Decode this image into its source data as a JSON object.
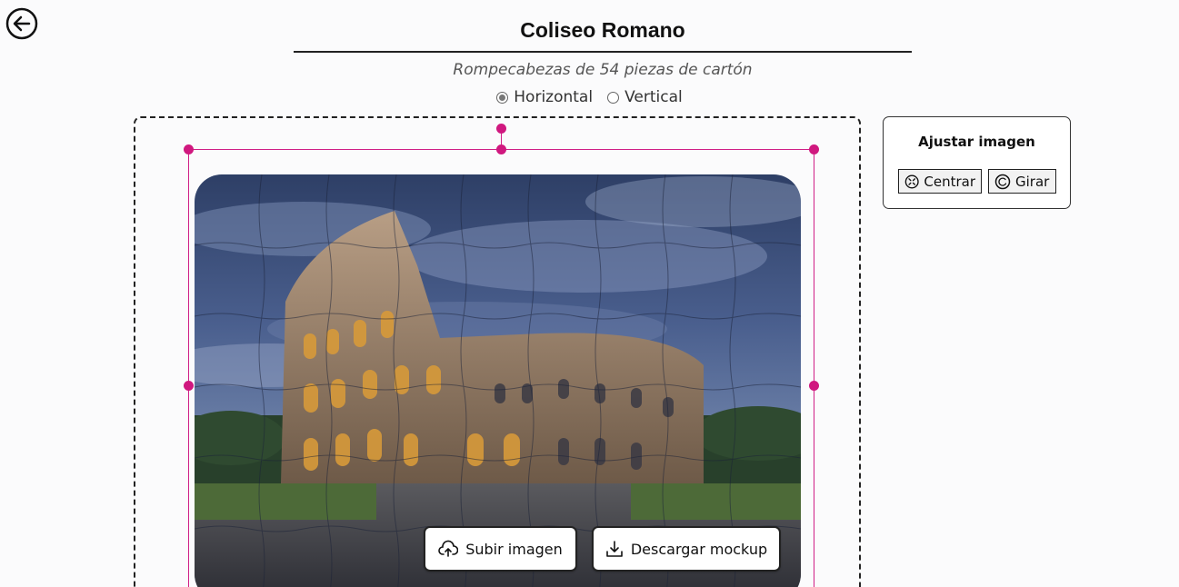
{
  "header": {
    "back_icon": "arrow-left-circle-icon",
    "title": "Coliseo Romano",
    "subtitle": "Rompecabezas de 54 piezas de cartón"
  },
  "orientation": {
    "options": [
      {
        "label": "Horizontal",
        "selected": true
      },
      {
        "label": "Vertical",
        "selected": false
      }
    ]
  },
  "editor": {
    "image_description_icon": "colosseum-puzzle-image",
    "selection_color": "#d01f86"
  },
  "actions": {
    "upload_label": "Subir imagen",
    "upload_icon": "cloud-upload-icon",
    "download_label": "Descargar mockup",
    "download_icon": "download-icon"
  },
  "adjust_panel": {
    "title": "Ajustar imagen",
    "center_label": "Centrar",
    "center_icon": "center-icon",
    "rotate_label": "Girar",
    "rotate_icon": "rotate-icon"
  }
}
